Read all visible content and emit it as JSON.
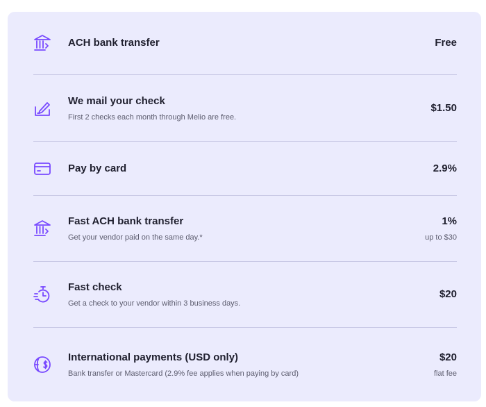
{
  "accent_color": "#7849ff",
  "card_background": "#ebebfd",
  "methods": [
    {
      "icon": "bank-transfer-icon",
      "title": "ACH bank transfer",
      "subtitle": "",
      "price": "Free",
      "price_note": ""
    },
    {
      "icon": "check-sign-icon",
      "title": "We mail your check",
      "subtitle": "First 2 checks each month through Melio are free.",
      "price": "$1.50",
      "price_note": ""
    },
    {
      "icon": "credit-card-icon",
      "title": "Pay by card",
      "subtitle": "",
      "price": "2.9%",
      "price_note": ""
    },
    {
      "icon": "fast-bank-transfer-icon",
      "title": "Fast ACH bank transfer",
      "subtitle": "Get your vendor paid on the same day.*",
      "price": "1%",
      "price_note": "up to $30"
    },
    {
      "icon": "fast-check-timer-icon",
      "title": "Fast check",
      "subtitle": "Get a check to your vendor within 3 business days.",
      "price": "$20",
      "price_note": ""
    },
    {
      "icon": "international-globe-icon",
      "title": "International payments (USD only)",
      "subtitle": "Bank transfer or Mastercard (2.9% fee applies when paying by card)",
      "price": "$20",
      "price_note": "flat fee"
    }
  ]
}
